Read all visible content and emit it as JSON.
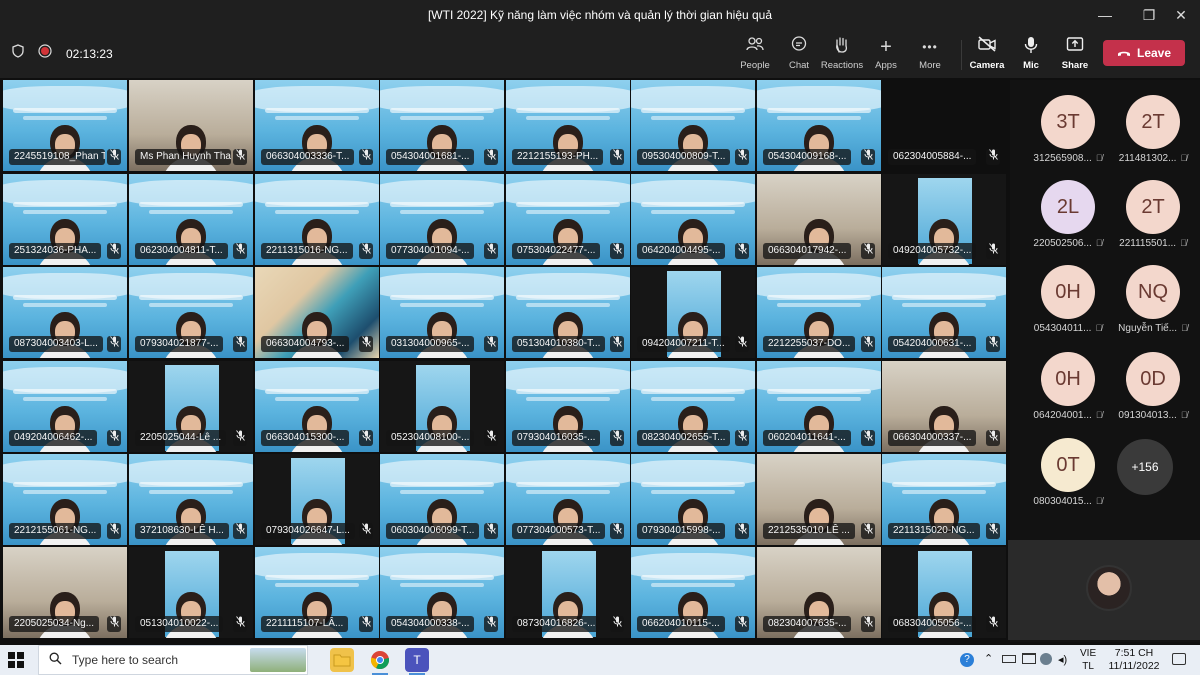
{
  "window": {
    "title": "[WTI 2022] Kỹ năng làm việc nhóm và quản lý thời gian hiệu quả",
    "minimize": "—",
    "maximize": "❐",
    "close": "✕"
  },
  "toolbar": {
    "timer": "02:13:23",
    "items": [
      {
        "label": "People",
        "icon": "people-icon",
        "glyph": "👥"
      },
      {
        "label": "Chat",
        "icon": "chat-icon",
        "glyph": "💬"
      },
      {
        "label": "Reactions",
        "icon": "reactions-icon",
        "glyph": "✋"
      },
      {
        "label": "Apps",
        "icon": "apps-icon",
        "glyph": "+"
      },
      {
        "label": "More",
        "icon": "more-icon",
        "glyph": "•••"
      },
      {
        "label": "Camera",
        "icon": "camera-off-icon",
        "glyph": "📹"
      },
      {
        "label": "Mic",
        "icon": "mic-icon",
        "glyph": "🎤"
      },
      {
        "label": "Share",
        "icon": "share-icon",
        "glyph": "⇪"
      }
    ],
    "leave_label": "Leave",
    "leave_color": "#c4314b"
  },
  "tiles": [
    "2245519108_Phan T...",
    "Ms Phan Huynh Tha...",
    "066304003336-T...",
    "054304001681-...",
    "2212155193-PH...",
    "095304000809-T...",
    "054304009168-...",
    "062304005884-...",
    "2513240​36-PHA...",
    "062304004811-T...",
    "2211315016-NG...",
    "077304001094-...",
    "075304022477-...",
    "064204004495-...",
    "066304017942-...",
    "049204005732-...",
    "087304003403-L...",
    "079304021877-...",
    "066304004793-...",
    "031304000965-...",
    "051304010380-T...",
    "094204007211-T...",
    "2212255037-DO...",
    "054204000631-...",
    "049204006462-...",
    "2205025044-Lê ...",
    "066304015300-...",
    "052304008100-...",
    "079304016035-...",
    "082304002655-T...",
    "060204011641-...",
    "066304000337-...",
    "2212155061-NG...",
    "372108630-LÊ H...",
    "079304026647-L...",
    "060304006099-T...",
    "077304000573-T...",
    "079304015998-...",
    "2212535010 LÊ ...",
    "2211315020-NG...",
    "2205025034-Ng...",
    "051304010022-...",
    "2211115107-LÂ...",
    "054304000338-...",
    "087304016826-...",
    "066204010115-...",
    "082304007635-...",
    "068304005056-..."
  ],
  "side_avatars": [
    {
      "initials": "3T",
      "label": "312565908...",
      "color": "#f3d7cc"
    },
    {
      "initials": "2T",
      "label": "211481302...",
      "color": "#f3d7cc"
    },
    {
      "initials": "2L",
      "label": "220502506...",
      "color": "#e6d8ef"
    },
    {
      "initials": "2T",
      "label": "221115501...",
      "color": "#f3d7cc"
    },
    {
      "initials": "0H",
      "label": "054304011...",
      "color": "#f3d7cc"
    },
    {
      "initials": "NQ",
      "label": "Nguyễn Tiế...",
      "color": "#f3d7cc"
    },
    {
      "initials": "0H",
      "label": "064204001...",
      "color": "#f3d7cc"
    },
    {
      "initials": "0D",
      "label": "091304013...",
      "color": "#f3d7cc"
    },
    {
      "initials": "0T",
      "label": "080304015...",
      "color": "#f6ead0"
    }
  ],
  "more_count": "+156",
  "taskbar": {
    "search_placeholder": "Type here to search",
    "lang_line1": "VIE",
    "lang_line2": "TL",
    "time": "7:51 CH",
    "date": "11/11/2022"
  }
}
